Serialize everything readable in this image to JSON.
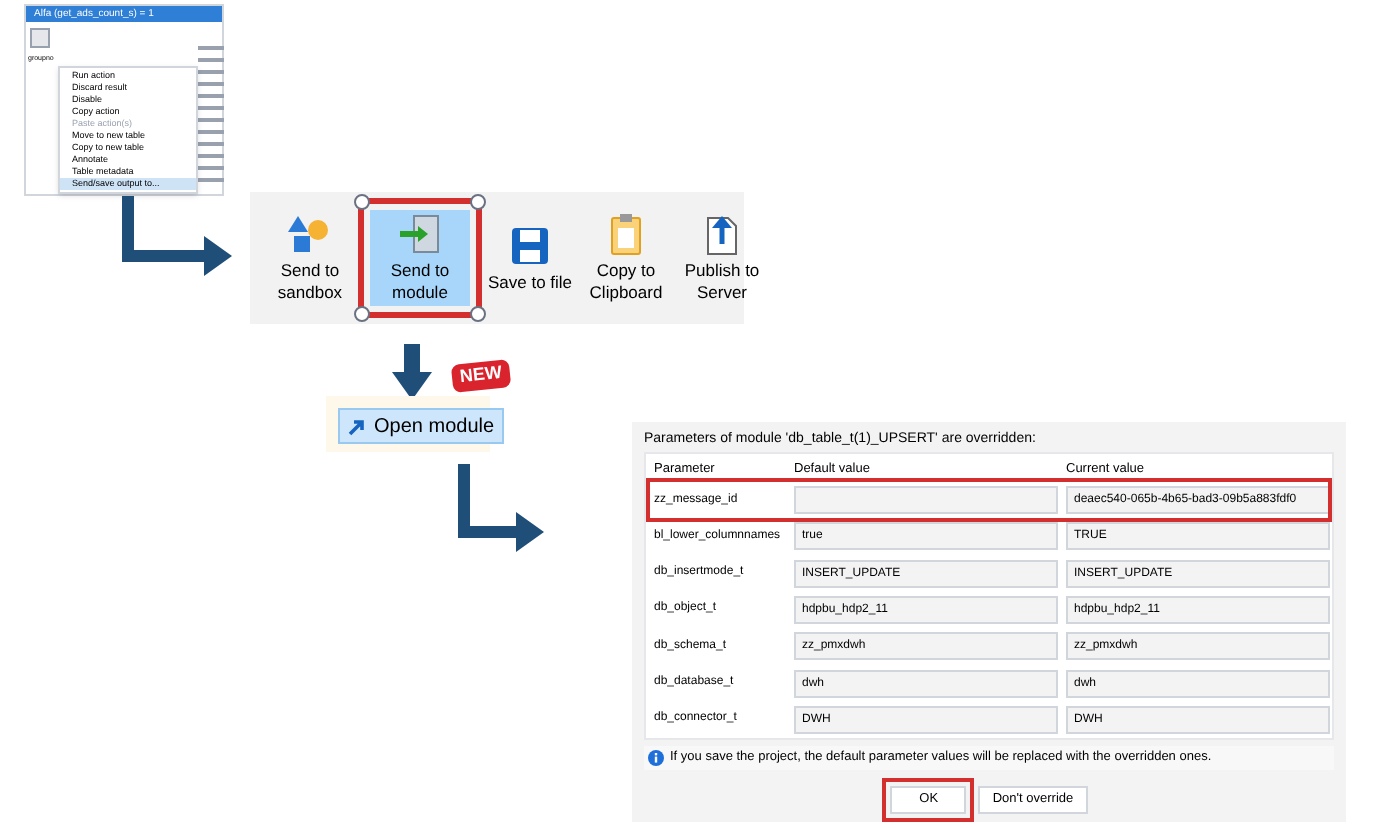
{
  "thumbnail": {
    "title": "Alfa (get_ads_count_s) = 1",
    "column_header": "groupno",
    "menu": [
      {
        "label": "Run action",
        "disabled": false,
        "selected": false
      },
      {
        "label": "Discard result",
        "disabled": false,
        "selected": false
      },
      {
        "label": "Disable",
        "disabled": false,
        "selected": false
      },
      {
        "label": "Copy action",
        "disabled": false,
        "selected": false
      },
      {
        "label": "Paste action(s)",
        "disabled": true,
        "selected": false
      },
      {
        "label": "Move to new table",
        "disabled": false,
        "selected": false
      },
      {
        "label": "Copy to new table",
        "disabled": false,
        "selected": false
      },
      {
        "label": "Annotate",
        "disabled": false,
        "selected": false
      },
      {
        "label": "Table metadata",
        "disabled": false,
        "selected": false
      },
      {
        "label": "Send/save output to...",
        "disabled": false,
        "selected": true
      }
    ]
  },
  "toolbar": [
    {
      "label": "Send to sandbox",
      "kind": "sandbox",
      "selected": false
    },
    {
      "label": "Send to module",
      "kind": "module",
      "selected": true
    },
    {
      "label": "Save to file",
      "kind": "save",
      "selected": false
    },
    {
      "label": "Copy to Clipboard",
      "kind": "clipboard",
      "selected": false
    },
    {
      "label": "Publish to Server",
      "kind": "publish",
      "selected": false
    }
  ],
  "new_badge": "NEW",
  "open_module_button": "Open module",
  "dialog": {
    "title": "Parameters of module 'db_table_t(1)_UPSERT' are overridden:",
    "columns": [
      "Parameter",
      "Default value",
      "Current value"
    ],
    "rows": [
      {
        "parameter": "zz_message_id",
        "default": "",
        "current": "deaec540-065b-4b65-bad3-09b5a883fdf0",
        "highlighted": true
      },
      {
        "parameter": "bl_lower_columnnames",
        "default": "true",
        "current": "TRUE",
        "highlighted": false
      },
      {
        "parameter": "db_insertmode_t",
        "default": "INSERT_UPDATE",
        "current": "INSERT_UPDATE",
        "highlighted": false
      },
      {
        "parameter": "db_object_t",
        "default": "hdpbu_hdp2_11",
        "current": "hdpbu_hdp2_11",
        "highlighted": false
      },
      {
        "parameter": "db_schema_t",
        "default": "zz_pmxdwh",
        "current": "zz_pmxdwh",
        "highlighted": false
      },
      {
        "parameter": "db_database_t",
        "default": "dwh",
        "current": "dwh",
        "highlighted": false
      },
      {
        "parameter": "db_connector_t",
        "default": "DWH",
        "current": "DWH",
        "highlighted": false
      }
    ],
    "info": "If you save the project, the default parameter values will be replaced with the overridden ones.",
    "buttons": [
      {
        "label": "OK",
        "highlighted": true
      },
      {
        "label": "Don't override",
        "highlighted": false
      }
    ]
  }
}
